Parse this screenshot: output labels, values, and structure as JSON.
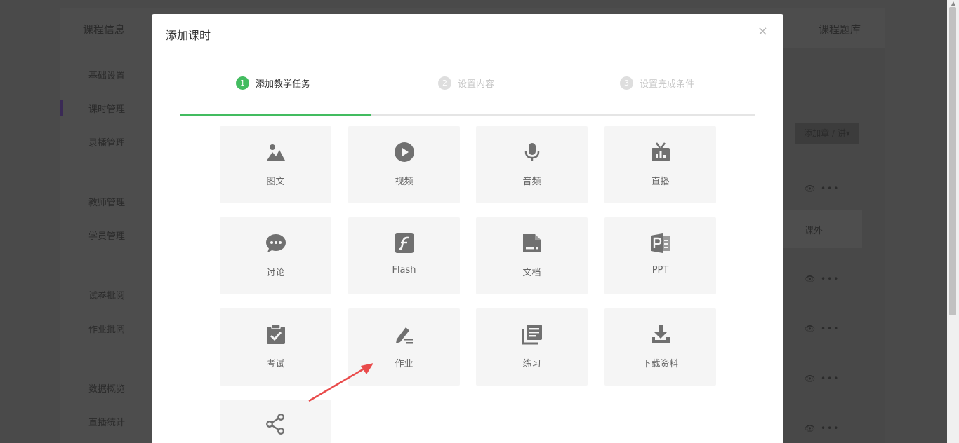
{
  "background": {
    "header_left": "课程信息",
    "header_right": "课程题库",
    "sidebar_items": [
      "基础设置",
      "课时管理",
      "录播管理",
      "教师管理",
      "学员管理",
      "试卷批阅",
      "作业批阅",
      "数据概览",
      "直播统计"
    ],
    "add_chapter_label": "添加章 / 讲▾",
    "row_icons": "👁 •••",
    "outside_label": "课外"
  },
  "modal": {
    "title": "添加课时",
    "close_symbol": "×",
    "steps": [
      {
        "num": "1",
        "label": "添加教学任务",
        "state": "active"
      },
      {
        "num": "2",
        "label": "设置内容",
        "state": "inactive"
      },
      {
        "num": "3",
        "label": "设置完成条件",
        "state": "inactive"
      }
    ],
    "tiles": [
      {
        "label": "图文",
        "icon": "image-icon"
      },
      {
        "label": "视频",
        "icon": "play-icon"
      },
      {
        "label": "音频",
        "icon": "microphone-icon"
      },
      {
        "label": "直播",
        "icon": "tv-icon"
      },
      {
        "label": "讨论",
        "icon": "chat-icon"
      },
      {
        "label": "Flash",
        "icon": "flash-icon"
      },
      {
        "label": "文档",
        "icon": "document-icon"
      },
      {
        "label": "PPT",
        "icon": "ppt-icon"
      },
      {
        "label": "考试",
        "icon": "clipboard-check-icon"
      },
      {
        "label": "作业",
        "icon": "pencil-icon"
      },
      {
        "label": "练习",
        "icon": "list-icon"
      },
      {
        "label": "下载资料",
        "icon": "download-icon"
      },
      {
        "label": "",
        "icon": "share-icon"
      }
    ]
  },
  "colors": {
    "accent": "#43bc60",
    "icon": "#707070",
    "arrow": "#e94b4b"
  }
}
